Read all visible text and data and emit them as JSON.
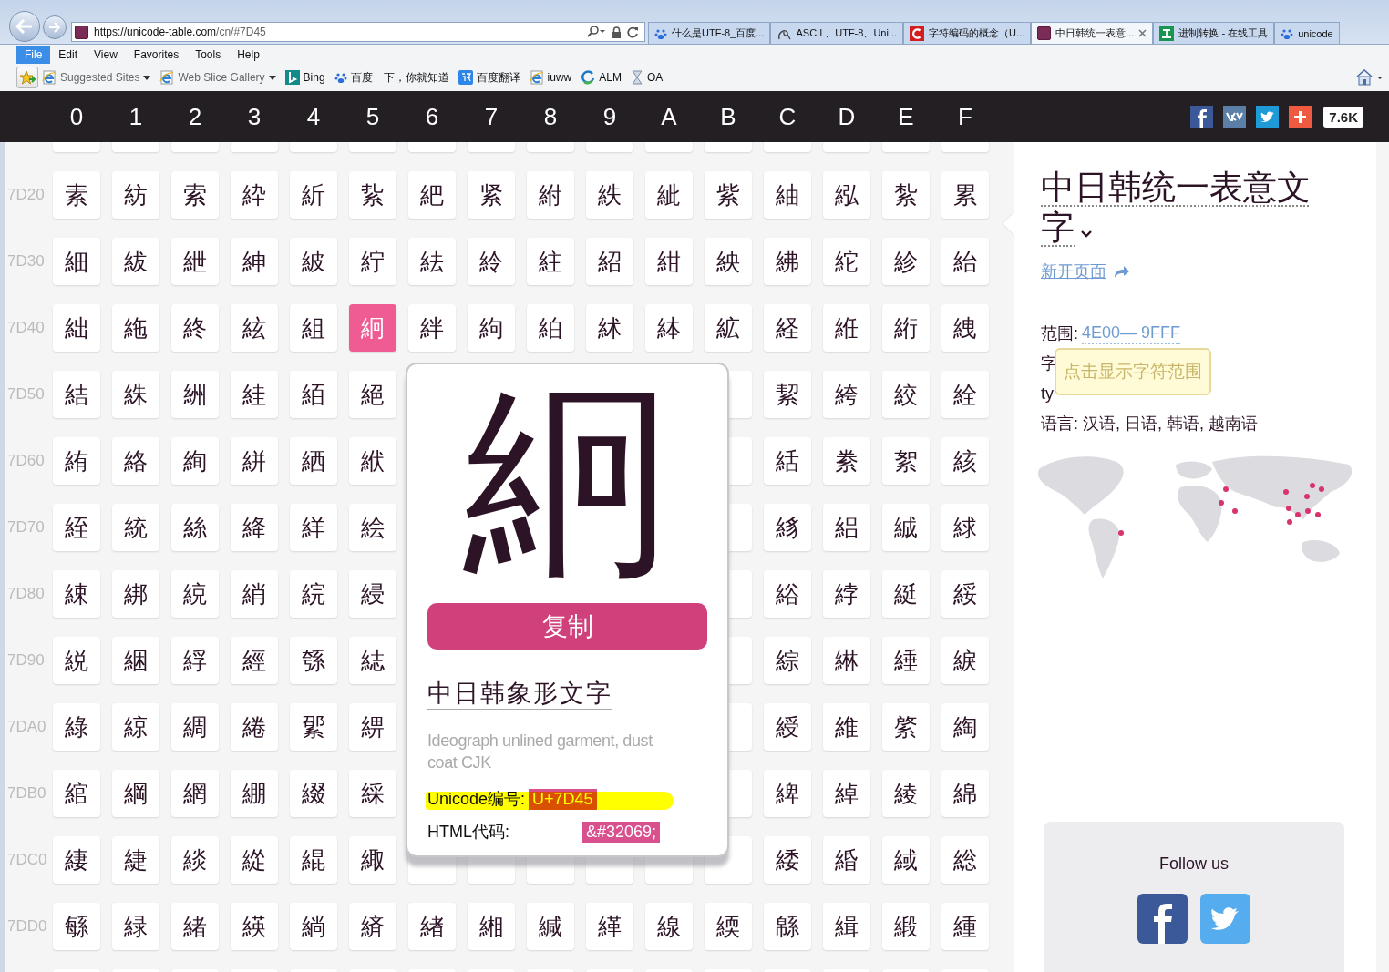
{
  "browser": {
    "address": {
      "host": "https://unicode-table.com",
      "path": "/cn/#7D45"
    },
    "tabs": [
      {
        "kind": "paw",
        "label": "什么是UTF-8_百度...",
        "selected": false
      },
      {
        "kind": "curl",
        "label": "ASCII 、UTF-8、Uni...",
        "selected": false
      },
      {
        "kind": "c",
        "label": "字符编码的概念（U...",
        "selected": false
      },
      {
        "kind": "ui",
        "label": "中日韩统一表意...",
        "selected": true
      },
      {
        "kind": "gong",
        "label": "进制转换 - 在线工具",
        "selected": false
      },
      {
        "kind": "paw",
        "label": "unicode",
        "selected": false
      }
    ],
    "menu": [
      {
        "label": "File",
        "selected": true
      },
      {
        "label": "Edit",
        "selected": false
      },
      {
        "label": "View",
        "selected": false
      },
      {
        "label": "Favorites",
        "selected": false
      },
      {
        "label": "Tools",
        "selected": false
      },
      {
        "label": "Help",
        "selected": false
      }
    ],
    "favorites": [
      {
        "kind": "ie",
        "label": "Suggested Sites",
        "dropdown": true
      },
      {
        "kind": "ie",
        "label": "Web Slice Gallery",
        "dropdown": true
      },
      {
        "kind": "bing",
        "label": "Bing",
        "dropdown": false
      },
      {
        "kind": "paw",
        "label": "百度一下，你就知道",
        "dropdown": false
      },
      {
        "kind": "translate",
        "label": "百度翻译",
        "dropdown": false
      },
      {
        "kind": "ie",
        "label": "iuww",
        "dropdown": false
      },
      {
        "kind": "ring",
        "label": "ALM",
        "dropdown": false
      },
      {
        "kind": "hourglass",
        "label": "OA",
        "dropdown": false
      }
    ]
  },
  "header": {
    "columns": [
      "0",
      "1",
      "2",
      "3",
      "4",
      "5",
      "6",
      "7",
      "8",
      "9",
      "A",
      "B",
      "C",
      "D",
      "E",
      "F"
    ],
    "share_count": "7.6K"
  },
  "grid": {
    "rows": [
      {
        "label": "7D20",
        "cells": [
          {
            "char": "素",
            "selected": false
          },
          {
            "char": "紡",
            "selected": false
          },
          {
            "char": "索",
            "selected": false
          },
          {
            "char": "紣",
            "selected": false
          },
          {
            "char": "紤",
            "selected": false
          },
          {
            "char": "紥",
            "selected": false
          },
          {
            "char": "紦",
            "selected": false
          },
          {
            "char": "紧",
            "selected": false
          },
          {
            "char": "紨",
            "selected": false
          },
          {
            "char": "紩",
            "selected": false
          },
          {
            "char": "紪",
            "selected": false
          },
          {
            "char": "紫",
            "selected": false
          },
          {
            "char": "紬",
            "selected": false
          },
          {
            "char": "紭",
            "selected": false
          },
          {
            "char": "紮",
            "selected": false
          },
          {
            "char": "累",
            "selected": false
          }
        ]
      },
      {
        "label": "7D30",
        "cells": [
          {
            "char": "細",
            "selected": false
          },
          {
            "char": "紱",
            "selected": false
          },
          {
            "char": "紲",
            "selected": false
          },
          {
            "char": "紳",
            "selected": false
          },
          {
            "char": "紴",
            "selected": false
          },
          {
            "char": "紵",
            "selected": false
          },
          {
            "char": "紶",
            "selected": false
          },
          {
            "char": "紷",
            "selected": false
          },
          {
            "char": "紸",
            "selected": false
          },
          {
            "char": "紹",
            "selected": false
          },
          {
            "char": "紺",
            "selected": false
          },
          {
            "char": "紻",
            "selected": false
          },
          {
            "char": "紼",
            "selected": false
          },
          {
            "char": "紽",
            "selected": false
          },
          {
            "char": "紾",
            "selected": false
          },
          {
            "char": "紿",
            "selected": false
          }
        ]
      },
      {
        "label": "7D40",
        "cells": [
          {
            "char": "絀",
            "selected": false
          },
          {
            "char": "絁",
            "selected": false
          },
          {
            "char": "終",
            "selected": false
          },
          {
            "char": "絃",
            "selected": false
          },
          {
            "char": "組",
            "selected": false
          },
          {
            "char": "絅",
            "selected": true
          },
          {
            "char": "絆",
            "selected": false
          },
          {
            "char": "絇",
            "selected": false
          },
          {
            "char": "絈",
            "selected": false
          },
          {
            "char": "絉",
            "selected": false
          },
          {
            "char": "絊",
            "selected": false
          },
          {
            "char": "絋",
            "selected": false
          },
          {
            "char": "経",
            "selected": false
          },
          {
            "char": "絍",
            "selected": false
          },
          {
            "char": "絎",
            "selected": false
          },
          {
            "char": "絏",
            "selected": false
          }
        ]
      },
      {
        "label": "7D50",
        "cells": [
          {
            "char": "結",
            "selected": false
          },
          {
            "char": "絑",
            "selected": false
          },
          {
            "char": "絒",
            "selected": false
          },
          {
            "char": "絓",
            "selected": false
          },
          {
            "char": "絔",
            "selected": false
          },
          {
            "char": "絕",
            "selected": false
          },
          null,
          null,
          null,
          null,
          null,
          null,
          {
            "char": "絜",
            "selected": false
          },
          {
            "char": "絝",
            "selected": false
          },
          {
            "char": "絞",
            "selected": false
          },
          {
            "char": "絟",
            "selected": false
          }
        ]
      },
      {
        "label": "7D60",
        "cells": [
          {
            "char": "絠",
            "selected": false
          },
          {
            "char": "絡",
            "selected": false
          },
          {
            "char": "絢",
            "selected": false
          },
          {
            "char": "絣",
            "selected": false
          },
          {
            "char": "絤",
            "selected": false
          },
          {
            "char": "絥",
            "selected": false
          },
          null,
          null,
          null,
          null,
          null,
          null,
          {
            "char": "絬",
            "selected": false
          },
          {
            "char": "絭",
            "selected": false
          },
          {
            "char": "絮",
            "selected": false
          },
          {
            "char": "絯",
            "selected": false
          }
        ]
      },
      {
        "label": "7D70",
        "cells": [
          {
            "char": "絰",
            "selected": false
          },
          {
            "char": "統",
            "selected": false
          },
          {
            "char": "絲",
            "selected": false
          },
          {
            "char": "絳",
            "selected": false
          },
          {
            "char": "絴",
            "selected": false
          },
          {
            "char": "絵",
            "selected": false
          },
          null,
          null,
          null,
          null,
          null,
          null,
          {
            "char": "絼",
            "selected": false
          },
          {
            "char": "絽",
            "selected": false
          },
          {
            "char": "絾",
            "selected": false
          },
          {
            "char": "絿",
            "selected": false
          }
        ]
      },
      {
        "label": "7D80",
        "cells": [
          {
            "char": "綀",
            "selected": false
          },
          {
            "char": "綁",
            "selected": false
          },
          {
            "char": "綂",
            "selected": false
          },
          {
            "char": "綃",
            "selected": false
          },
          {
            "char": "綄",
            "selected": false
          },
          {
            "char": "綅",
            "selected": false
          },
          null,
          null,
          null,
          null,
          null,
          null,
          {
            "char": "綌",
            "selected": false
          },
          {
            "char": "綍",
            "selected": false
          },
          {
            "char": "綎",
            "selected": false
          },
          {
            "char": "綏",
            "selected": false
          }
        ]
      },
      {
        "label": "7D90",
        "cells": [
          {
            "char": "綐",
            "selected": false
          },
          {
            "char": "綑",
            "selected": false
          },
          {
            "char": "綒",
            "selected": false
          },
          {
            "char": "經",
            "selected": false
          },
          {
            "char": "綔",
            "selected": false
          },
          {
            "char": "綕",
            "selected": false
          },
          null,
          null,
          null,
          null,
          null,
          null,
          {
            "char": "綜",
            "selected": false
          },
          {
            "char": "綝",
            "selected": false
          },
          {
            "char": "綞",
            "selected": false
          },
          {
            "char": "綟",
            "selected": false
          }
        ]
      },
      {
        "label": "7DA0",
        "cells": [
          {
            "char": "綠",
            "selected": false
          },
          {
            "char": "綡",
            "selected": false
          },
          {
            "char": "綢",
            "selected": false
          },
          {
            "char": "綣",
            "selected": false
          },
          {
            "char": "綤",
            "selected": false
          },
          {
            "char": "綥",
            "selected": false
          },
          null,
          null,
          null,
          null,
          null,
          null,
          {
            "char": "綬",
            "selected": false
          },
          {
            "char": "維",
            "selected": false
          },
          {
            "char": "綮",
            "selected": false
          },
          {
            "char": "綯",
            "selected": false
          }
        ]
      },
      {
        "label": "7DB0",
        "cells": [
          {
            "char": "綰",
            "selected": false
          },
          {
            "char": "綱",
            "selected": false
          },
          {
            "char": "網",
            "selected": false
          },
          {
            "char": "綳",
            "selected": false
          },
          {
            "char": "綴",
            "selected": false
          },
          {
            "char": "綵",
            "selected": false
          },
          null,
          null,
          null,
          null,
          null,
          null,
          {
            "char": "綼",
            "selected": false
          },
          {
            "char": "綽",
            "selected": false
          },
          {
            "char": "綾",
            "selected": false
          },
          {
            "char": "綿",
            "selected": false
          }
        ]
      },
      {
        "label": "7DC0",
        "cells": [
          {
            "char": "緀",
            "selected": false
          },
          {
            "char": "緁",
            "selected": false
          },
          {
            "char": "緂",
            "selected": false
          },
          {
            "char": "緃",
            "selected": false
          },
          {
            "char": "緄",
            "selected": false
          },
          {
            "char": "緅",
            "selected": false
          },
          null,
          null,
          null,
          null,
          null,
          null,
          {
            "char": "緌",
            "selected": false
          },
          {
            "char": "緍",
            "selected": false
          },
          {
            "char": "緎",
            "selected": false
          },
          {
            "char": "総",
            "selected": false
          }
        ]
      },
      {
        "label": "7DD0",
        "cells": [
          {
            "char": "緐",
            "selected": false
          },
          {
            "char": "緑",
            "selected": false
          },
          {
            "char": "緒",
            "selected": false
          },
          {
            "char": "緓",
            "selected": false
          },
          {
            "char": "緔",
            "selected": false
          },
          {
            "char": "緕",
            "selected": false
          },
          {
            "char": "緖",
            "selected": false
          },
          {
            "char": "緗",
            "selected": false
          },
          {
            "char": "緘",
            "selected": false
          },
          {
            "char": "緙",
            "selected": false
          },
          {
            "char": "線",
            "selected": false
          },
          {
            "char": "緛",
            "selected": false
          },
          {
            "char": "緜",
            "selected": false
          },
          {
            "char": "緝",
            "selected": false
          },
          {
            "char": "緞",
            "selected": false
          },
          {
            "char": "緟",
            "selected": false
          }
        ]
      }
    ]
  },
  "popup": {
    "char": "絅",
    "copy_button": "复制",
    "name": "中日韩象形文字",
    "description": "Ideograph unlined garment, dust coat CJK",
    "unicode": {
      "label": "Unicode编号:",
      "value": "U+7D45"
    },
    "html": {
      "label": "HTML代码:",
      "value": "&#32069;"
    }
  },
  "panel": {
    "title": "中日韩统一表意文字",
    "open_link": "新开页面",
    "range": {
      "label": "范围:",
      "value": "4E00— 9FFF"
    },
    "hidden_lines": [
      "字",
      "ty"
    ],
    "tooltip": "点击显示字符范围",
    "languages": "语言: 汉语, 日语, 韩语, 越南语",
    "follow": {
      "title": "Follow us"
    }
  }
}
